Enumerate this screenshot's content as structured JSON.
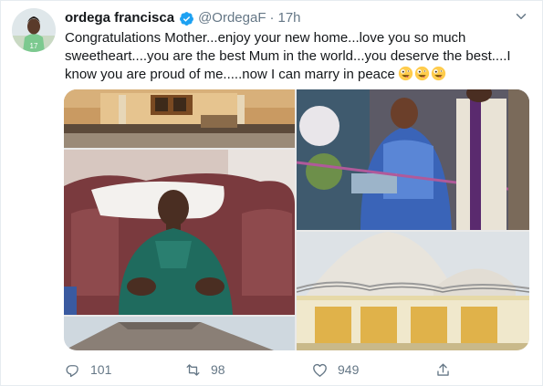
{
  "tweet": {
    "display_name": "ordega francisca",
    "handle": "@OrdegaF",
    "separator": "·",
    "time": "17h",
    "text": "Congratulations Mother...enjoy your new home...love you so much sweetheart....you are the best Mum in the world...you deserve the best....I know you are proud of me.....now I can marry in peace",
    "emojis": [
      "zany-face-emoji",
      "zany-face-emoji",
      "zany-face-emoji"
    ]
  },
  "icons": {
    "verified": "verified-badge-icon",
    "more": "chevron-down-icon",
    "reply": "reply-icon",
    "retweet": "retweet-icon",
    "like": "heart-icon",
    "share": "share-icon"
  },
  "actions": {
    "reply_count": "101",
    "retweet_count": "98",
    "like_count": "949"
  },
  "colors": {
    "verified_blue": "#1da1f2",
    "muted_gray": "#657786",
    "text": "#14171a"
  }
}
